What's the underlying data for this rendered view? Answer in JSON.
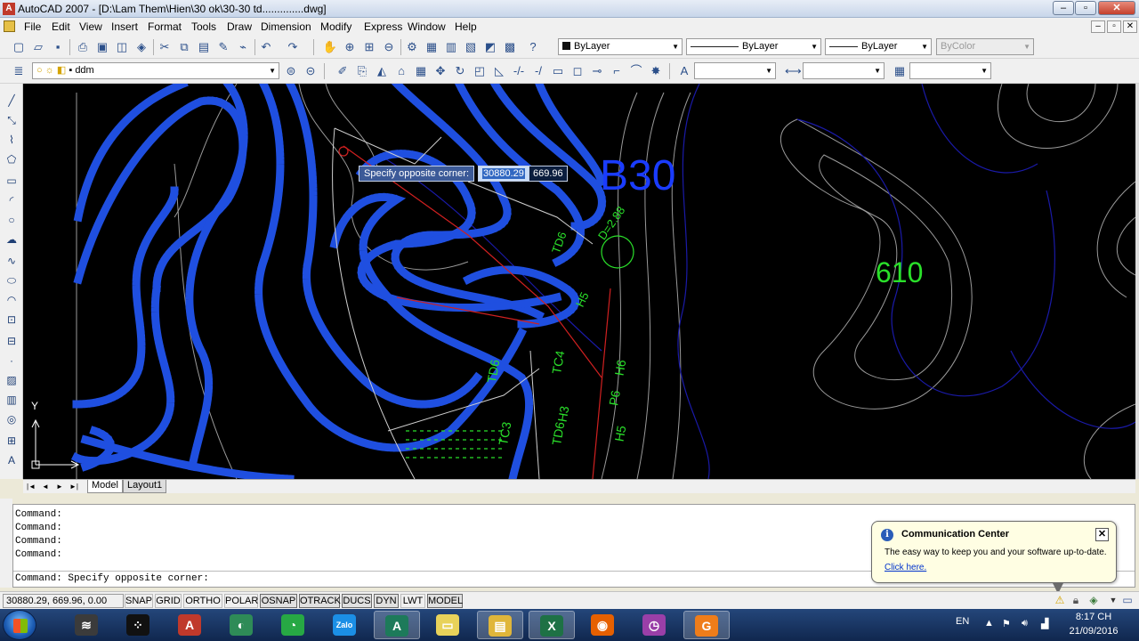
{
  "window": {
    "title": "AutoCAD 2007 - [D:\\Lam Them\\Hien\\30 ok\\30-30 td..............dwg]",
    "controls": [
      "–",
      "▫",
      "✕"
    ]
  },
  "menu": {
    "items": [
      "File",
      "Edit",
      "View",
      "Insert",
      "Format",
      "Tools",
      "Draw",
      "Dimension",
      "Modify",
      "Express",
      "Window",
      "Help"
    ],
    "mdi_controls": [
      "–",
      "▫",
      "✕"
    ]
  },
  "properties": {
    "color": "ByLayer",
    "linetype": "ByLayer",
    "lineweight": "ByLayer",
    "plotstyle": "ByColor"
  },
  "layer": {
    "current": "ddm"
  },
  "drawing": {
    "background": "#000000",
    "contour_color": "#1f4fe0",
    "labels": [
      {
        "text": "B30",
        "color": "#1a3cff"
      },
      {
        "text": "610",
        "color": "#2ae02a"
      },
      {
        "text": "TD6",
        "color": "#2ae02a"
      },
      {
        "text": "D=2.88",
        "color": "#2ae02a"
      },
      {
        "text": "H5",
        "color": "#2ae02a"
      },
      {
        "text": "TD6",
        "color": "#2ae02a"
      },
      {
        "text": "TC4",
        "color": "#2ae02a"
      },
      {
        "text": "H6",
        "color": "#2ae02a"
      },
      {
        "text": "P6",
        "color": "#2ae02a"
      },
      {
        "text": "H5",
        "color": "#2ae02a"
      },
      {
        "text": "TC3",
        "color": "#2ae02a"
      },
      {
        "text": "TD6",
        "color": "#2ae02a"
      },
      {
        "text": "H3",
        "color": "#2ae02a"
      }
    ],
    "ucs": {
      "y_label": "Y"
    }
  },
  "dynamic_input": {
    "prompt": "Specify opposite corner:",
    "x_value": "30880.29",
    "y_value": "669.96"
  },
  "layout_tabs": {
    "nav": [
      "|◄",
      "◄",
      "►",
      "►|"
    ],
    "tabs": [
      "Model",
      "Layout1"
    ]
  },
  "command_window": {
    "history": [
      "Command:",
      "Command:",
      "Command:",
      "Command:"
    ],
    "current": "Command: Specify opposite corner:"
  },
  "statusbar": {
    "coordinates": "30880.29, 669.96, 0.00",
    "toggles": [
      {
        "label": "SNAP",
        "on": false
      },
      {
        "label": "GRID",
        "on": false
      },
      {
        "label": "ORTHO",
        "on": false
      },
      {
        "label": "POLAR",
        "on": false
      },
      {
        "label": "OSNAP",
        "on": true
      },
      {
        "label": "OTRACK",
        "on": true
      },
      {
        "label": "DUCS",
        "on": true
      },
      {
        "label": "DYN",
        "on": true
      },
      {
        "label": "LWT",
        "on": false
      },
      {
        "label": "MODEL",
        "on": true
      }
    ]
  },
  "communication_center": {
    "title": "Communication Center",
    "text": "The easy way to keep you and your software up-to-date.",
    "link": "Click here."
  },
  "taskbar": {
    "apps": [
      {
        "name": "wifi-app-icon",
        "color": "#3b3b3b",
        "glyph": "≋"
      },
      {
        "name": "blackberry-icon",
        "color": "#111111",
        "glyph": "⁘"
      },
      {
        "name": "autocad-icon",
        "color": "#c0392b",
        "glyph": "A"
      },
      {
        "name": "ccleaner-icon",
        "color": "#2e8b57",
        "glyph": "◐"
      },
      {
        "name": "coccoc-icon",
        "color": "#27a844",
        "glyph": "◔"
      },
      {
        "name": "zalo-icon",
        "color": "#1b8fe6",
        "glyph": "Zalo"
      },
      {
        "name": "autocad-doc-icon",
        "color": "#1d7a5a",
        "glyph": "A"
      },
      {
        "name": "sticky-notes-icon",
        "color": "#e8d25a",
        "glyph": "▭"
      },
      {
        "name": "file-explorer-icon",
        "color": "#e0b63a",
        "glyph": "▤"
      },
      {
        "name": "excel-icon",
        "color": "#1e7145",
        "glyph": "X"
      },
      {
        "name": "firefox-icon",
        "color": "#e66000",
        "glyph": "◉"
      },
      {
        "name": "speedometer-icon",
        "color": "#9a3fa8",
        "glyph": "◷"
      },
      {
        "name": "foxit-icon",
        "color": "#ef7d1a",
        "glyph": "G"
      }
    ],
    "language": "EN",
    "time": "8:17 CH",
    "date": "21/09/2016"
  }
}
